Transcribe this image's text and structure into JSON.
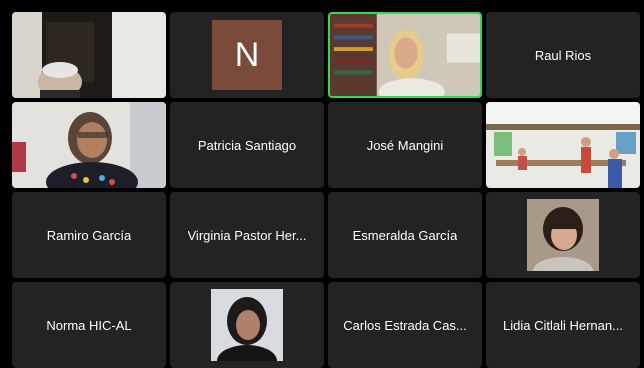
{
  "meeting": {
    "participants": [
      {
        "name": "",
        "type": "video"
      },
      {
        "name": "",
        "type": "initial",
        "initial": "N"
      },
      {
        "name": "",
        "type": "video",
        "active": true
      },
      {
        "name": "Raul Rios",
        "type": "name"
      },
      {
        "name": "",
        "type": "video"
      },
      {
        "name": "Patricia Santiago",
        "type": "name"
      },
      {
        "name": "José Mangini",
        "type": "name"
      },
      {
        "name": "",
        "type": "video"
      },
      {
        "name": "Ramiro García",
        "type": "name"
      },
      {
        "name": "Virginia Pastor Her...",
        "type": "name"
      },
      {
        "name": "Esmeralda García",
        "type": "name"
      },
      {
        "name": "",
        "type": "avatar"
      },
      {
        "name": "Norma HIC-AL",
        "type": "name"
      },
      {
        "name": "",
        "type": "avatar"
      },
      {
        "name": "Carlos Estrada Cas...",
        "type": "name"
      },
      {
        "name": "Lidia Citlali Hernan...",
        "type": "name"
      }
    ]
  },
  "colors": {
    "tile_bg": "#232323",
    "active_border": "#3ad64c",
    "initial_bg": "#7a4a3a"
  }
}
